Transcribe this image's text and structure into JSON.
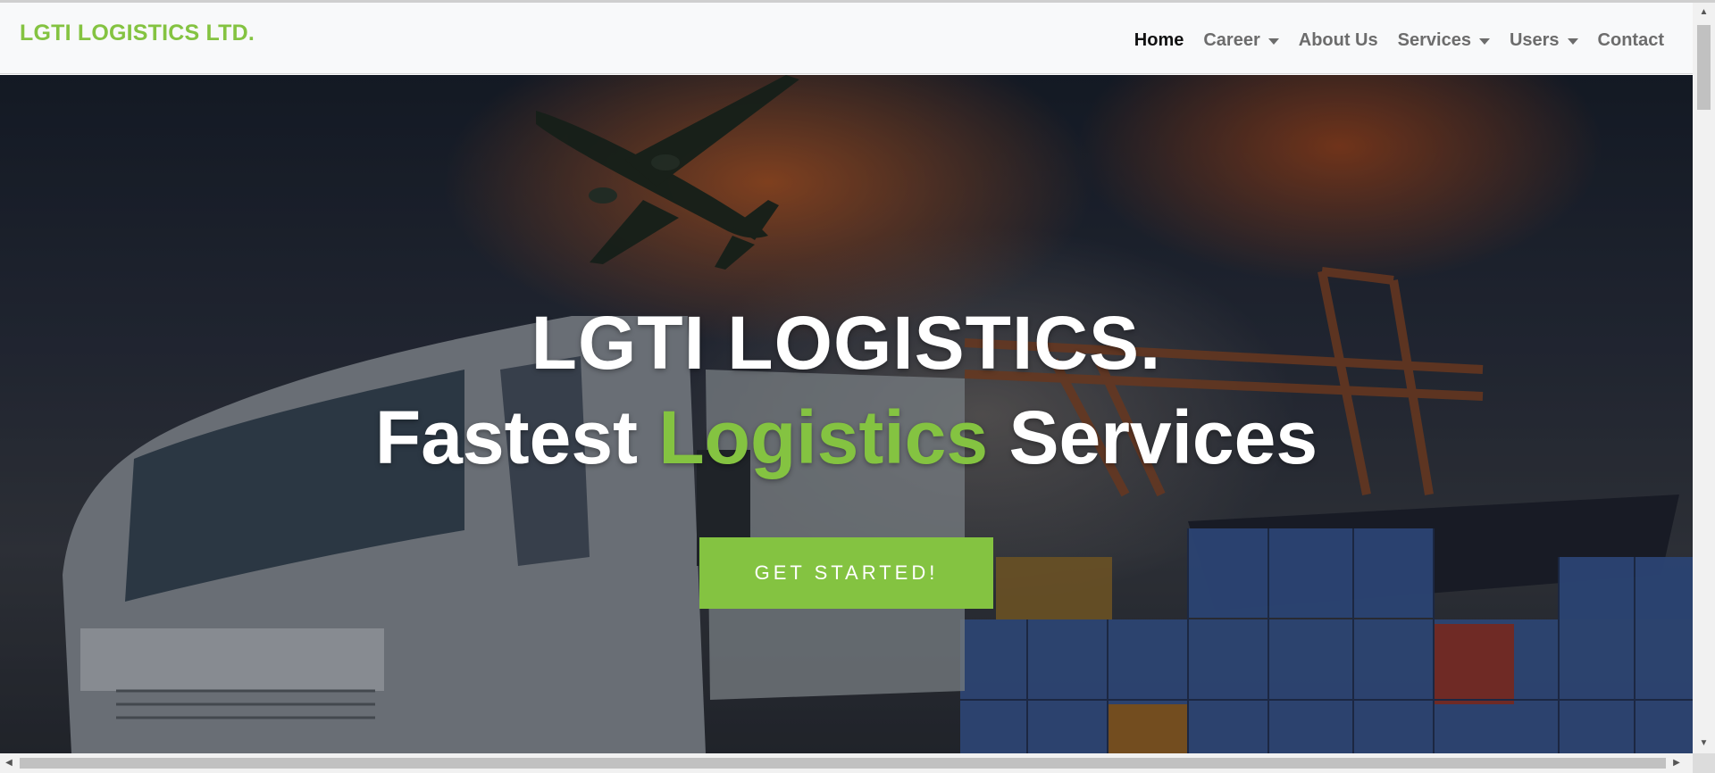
{
  "navbar": {
    "brand": "LGTI LOGISTICS LTD.",
    "items": [
      {
        "label": "Home",
        "active": true,
        "dropdown": false
      },
      {
        "label": "Career",
        "active": false,
        "dropdown": true
      },
      {
        "label": "About Us",
        "active": false,
        "dropdown": false
      },
      {
        "label": "Services",
        "active": false,
        "dropdown": true
      },
      {
        "label": "Users",
        "active": false,
        "dropdown": true
      },
      {
        "label": "Contact",
        "active": false,
        "dropdown": false
      }
    ]
  },
  "hero": {
    "title": "LGTI LOGISTICS.",
    "subtitle_part1": "Fastest ",
    "subtitle_accent": "Logistics",
    "subtitle_part2": " Services",
    "cta_label": "GET STARTED!"
  },
  "colors": {
    "accent": "#84c341",
    "navbar_bg": "#f8f9fa",
    "nav_text": "#6c6c6c",
    "nav_active": "#111111"
  }
}
